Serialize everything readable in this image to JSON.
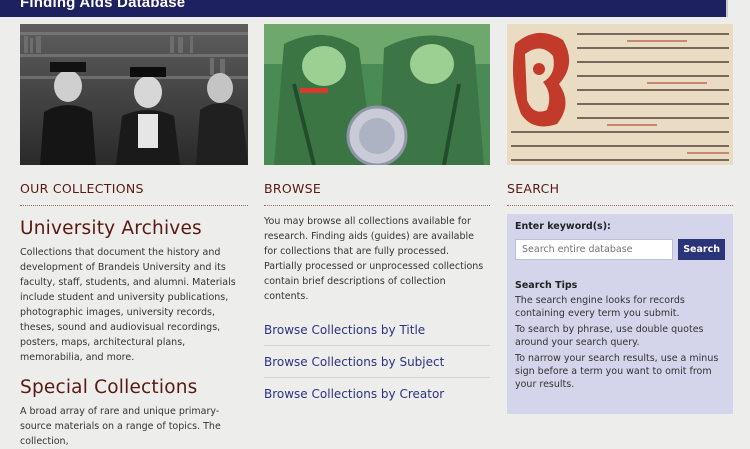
{
  "header": {
    "title": "Finding Aids Database"
  },
  "collections": {
    "section_title": "OUR COLLECTIONS",
    "archives_heading": "University Archives",
    "archives_text": "Collections that document the history and development of Brandeis University and its faculty, staff, students, and alumni. Materials include student and university publications, photographic images, university records, theses, sound and audiovisual recordings, posters, maps, architectural plans, memorabilia, and more.",
    "special_heading": "Special Collections",
    "special_text": "A broad array of rare and unique primary-source materials on a range of topics. The collection,"
  },
  "browse": {
    "section_title": "BROWSE",
    "intro": "You may browse all collections available for research. Finding aids (guides) are available for collections that are fully processed. Partially processed or unprocessed collections contain brief descriptions of collection contents.",
    "links": {
      "by_title": "Browse Collections by Title",
      "by_subject": "Browse Collections by Subject",
      "by_creator": "Browse Collections by Creator"
    }
  },
  "search": {
    "section_title": "SEARCH",
    "label": "Enter keyword(s):",
    "placeholder": "Search entire database",
    "button": "Search",
    "tips_title": "Search Tips",
    "tip1": "The search engine looks for records containing every term you submit.",
    "tip2": "To search by phrase, use double quotes around your search query.",
    "tip3": "To narrow your search results, use a minus sign before a term you want to omit from your results."
  },
  "colors": {
    "header_bg": "#1d2160",
    "heading": "#5a1812",
    "link": "#2d3182",
    "search_panel": "#d4d4ea",
    "search_button": "#2a3478"
  },
  "images": {
    "photo1": "black-and-white-photo-of-graduates",
    "photo2": "green-poster-soldiers",
    "photo3": "illuminated-manuscript"
  }
}
